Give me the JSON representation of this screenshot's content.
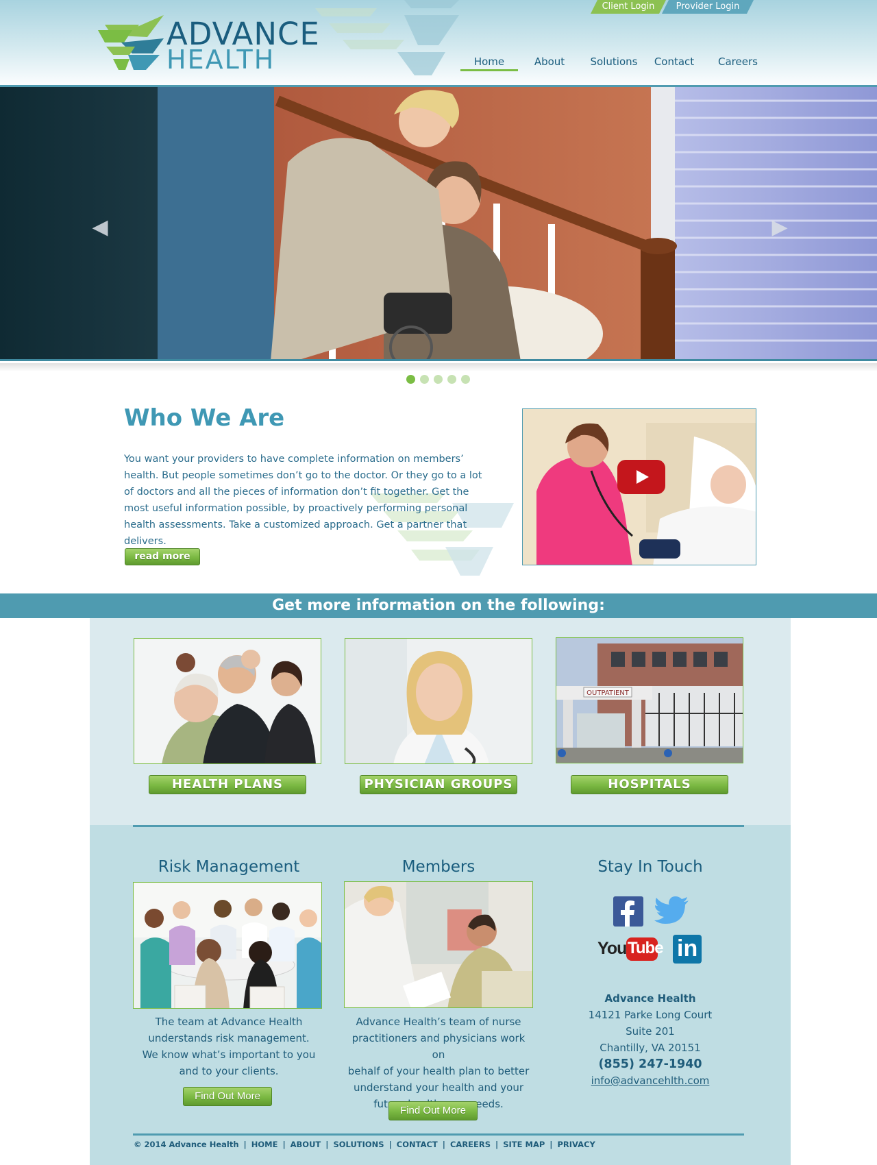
{
  "header": {
    "logo": {
      "line1": "ADVANCE",
      "line2": "HEALTH"
    },
    "login_links": {
      "client": "Client Login",
      "provider": "Provider Login"
    },
    "nav": [
      "Home",
      "About",
      "Solutions",
      "Contact",
      "Careers"
    ],
    "active_nav": "Home"
  },
  "hero": {
    "slide_count": 5,
    "active_slide": 1,
    "prev_arrow": "◀",
    "next_arrow": "▶"
  },
  "who": {
    "title": "Who We Are",
    "body": "You want your providers to have complete information on members’ health. But people sometimes don’t go to the doctor. Or they go to a lot of doctors and all the pieces of information don’t fit together. Get the most useful information possible, by proactively performing personal health assessments. Take a customized approach. Get a partner that delivers.",
    "button": "read more"
  },
  "info_bar": {
    "title": "Get more information on the following:"
  },
  "cards": [
    {
      "label": "HEALTH PLANS"
    },
    {
      "label": "PHYSICIAN GROUPS"
    },
    {
      "label": "HOSPITALS",
      "sign": "OUTPATIENT"
    }
  ],
  "columns": {
    "risk": {
      "title": "Risk Management",
      "lines": [
        "The team at Advance Health",
        "understands risk management.",
        "We know what’s important to you",
        "and to your clients."
      ],
      "button": "Find Out More"
    },
    "members": {
      "title": "Members",
      "lines": [
        "Advance Health’s team of nurse",
        "practitioners and physicians work on",
        "behalf of your health plan to better",
        "understand your health and your",
        "future health care needs."
      ],
      "button": "Find Out More"
    },
    "stay": {
      "title": "Stay In Touch",
      "social": [
        "facebook-icon",
        "twitter-icon",
        "youtube-icon",
        "linkedin-icon"
      ],
      "youtube_text": {
        "you": "You",
        "tube": "Tube"
      },
      "linkedin_text": "in"
    }
  },
  "contact": {
    "org": "Advance Health",
    "address1": "14121 Parke Long Court",
    "address2": "Suite 201",
    "address3": "Chantilly, VA 20151",
    "phone": "(855) 247-1940",
    "email": "info@advancehlth.com"
  },
  "footer": {
    "copyright": "© 2014 Advance Health",
    "links": [
      "HOME",
      "ABOUT",
      "SOLUTIONS",
      "CONTACT",
      "CAREERS",
      "SITE MAP",
      "PRIVACY"
    ],
    "separator": "|"
  },
  "colors": {
    "brand_blue": "#1a5d7e",
    "accent_teal": "#4f9bb0",
    "accent_green": "#7bbd44"
  }
}
